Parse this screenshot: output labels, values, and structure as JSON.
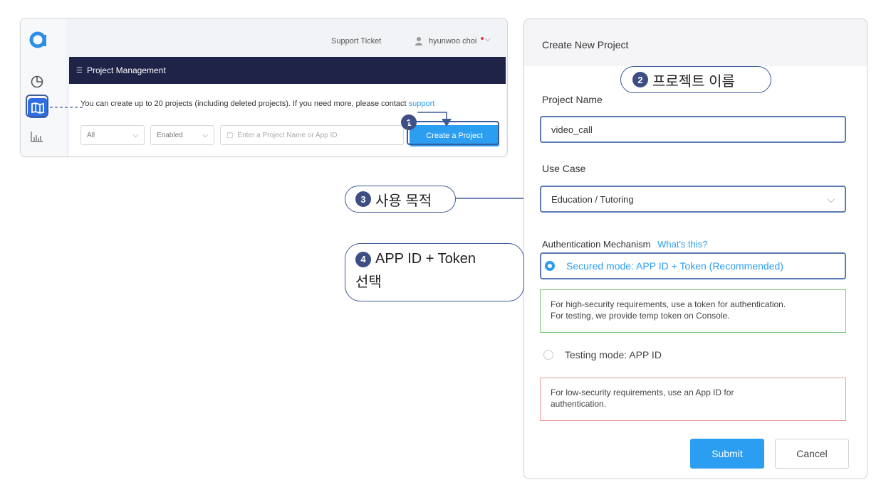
{
  "console": {
    "topbar": {
      "support_ticket": "Support Ticket",
      "user_name": "hyunwoo choi"
    },
    "panel_title": "Project Management",
    "info_text": "You can create up to 20 projects (including deleted projects). If you need more, please contact",
    "info_link": "support",
    "filters": {
      "type": "All",
      "status": "Enabled",
      "search_placeholder": "Enter a Project Name or App ID"
    },
    "create_button": "Create a Project"
  },
  "dialog": {
    "title": "Create New Project",
    "project_name_label": "Project Name",
    "project_name_value": "video_call",
    "use_case_label": "Use Case",
    "use_case_value": "Education / Tutoring",
    "auth_label": "Authentication Mechanism",
    "auth_help_link": "What's this?",
    "secured_option": "Secured mode: APP ID + Token (Recommended)",
    "secured_desc_line1": "For high-security requirements, use a token for authentication.",
    "secured_desc_line2": "For testing, we provide temp token on Console.",
    "testing_option": "Testing mode: APP ID",
    "testing_desc_line1": "For low-security requirements, use an App ID for",
    "testing_desc_line2": "authentication.",
    "submit": "Submit",
    "cancel": "Cancel"
  },
  "callouts": {
    "c1": {
      "num": "1"
    },
    "c2": {
      "num": "2",
      "text": "프로젝트 이름"
    },
    "c3": {
      "num": "3",
      "text": "사용 목적"
    },
    "c4": {
      "num": "4",
      "text_line1": "APP ID + Token",
      "text_line2": "선택"
    }
  },
  "colors": {
    "accent": "#2b9ef2",
    "navy": "#1e2347",
    "callout_border": "#3d5a98",
    "success": "#7cc576",
    "danger": "#e79a9a"
  }
}
